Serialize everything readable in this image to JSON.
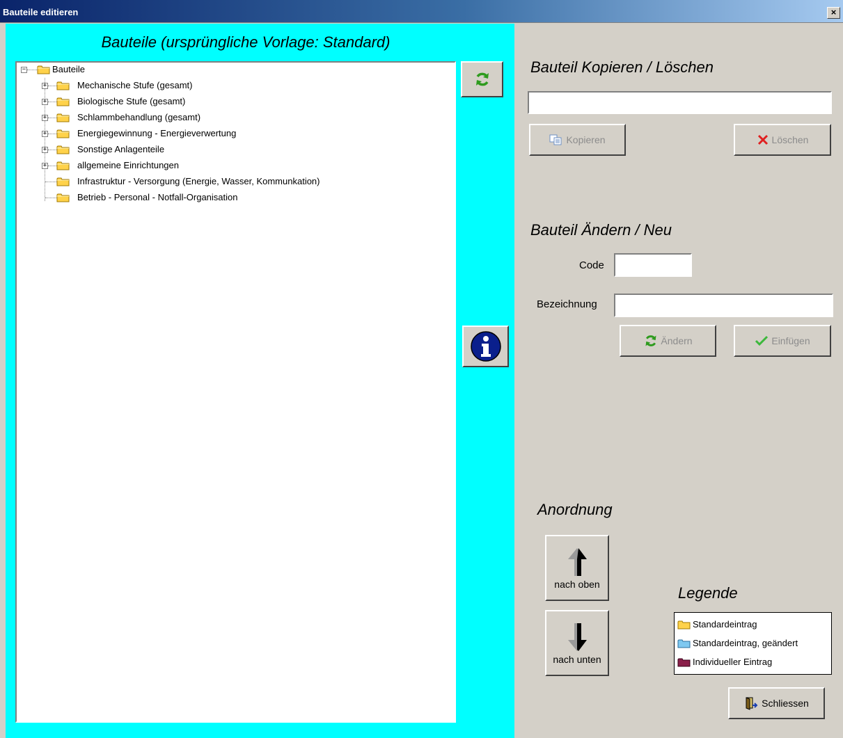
{
  "window": {
    "title": "Bauteile editieren",
    "close_label": "×"
  },
  "left_panel": {
    "title": "Bauteile (ursprüngliche Vorlage: Standard)",
    "tree": {
      "root": "Bauteile",
      "items": [
        {
          "label": "Mechanische Stufe (gesamt)",
          "expandable": true
        },
        {
          "label": "Biologische Stufe (gesamt)",
          "expandable": true
        },
        {
          "label": "Schlammbehandlung (gesamt)",
          "expandable": true
        },
        {
          "label": "Energiegewinnung - Energieverwertung",
          "expandable": true
        },
        {
          "label": "Sonstige Anlagenteile",
          "expandable": true
        },
        {
          "label": "allgemeine Einrichtungen",
          "expandable": true
        },
        {
          "label": "Infrastruktur - Versorgung (Energie, Wasser, Kommunkation)",
          "expandable": false
        },
        {
          "label": "Betrieb - Personal - Notfall-Organisation",
          "expandable": false
        }
      ]
    }
  },
  "copy_delete": {
    "heading": "Bauteil Kopieren / Löschen",
    "name_value": "",
    "copy_label": "Kopieren",
    "delete_label": "Löschen"
  },
  "edit_new": {
    "heading": "Bauteil Ändern / Neu",
    "code_label": "Code",
    "code_value": "",
    "name_label": "Bezeichnung",
    "name_value": "",
    "change_label": "Ändern",
    "insert_label": "Einfügen"
  },
  "order": {
    "heading": "Anordnung",
    "up_label": "nach oben",
    "down_label": "nach unten"
  },
  "legend": {
    "heading": "Legende",
    "items": [
      {
        "label": "Standardeintrag",
        "color": "#ffd24a"
      },
      {
        "label": "Standardeintrag, geändert",
        "color": "#7ec8f0"
      },
      {
        "label": "Individueller Eintrag",
        "color": "#8a1f4a"
      }
    ]
  },
  "close_button_label": "Schliessen"
}
